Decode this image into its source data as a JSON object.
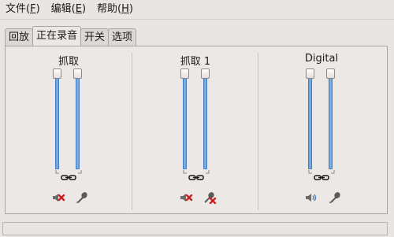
{
  "menu": {
    "file": {
      "label": "文件(",
      "accel": "F",
      "tail": ")"
    },
    "edit": {
      "label": "编辑(",
      "accel": "E",
      "tail": ")"
    },
    "help": {
      "label": "帮助(",
      "accel": "H",
      "tail": ")"
    }
  },
  "tabs": [
    {
      "label": "回放",
      "active": false
    },
    {
      "label": "正在录音",
      "active": true
    },
    {
      "label": "开关",
      "active": false
    },
    {
      "label": "选项",
      "active": false
    }
  ],
  "groups": [
    {
      "title": "抓取",
      "sliders": [
        1.0,
        1.0
      ],
      "locked": true,
      "icons": [
        "mute-icon",
        "microphone-icon"
      ]
    },
    {
      "title": "抓取 1",
      "sliders": [
        1.0,
        1.0
      ],
      "locked": true,
      "icons": [
        "mute-icon",
        "microphone-muted-icon"
      ]
    },
    {
      "title": "Digital",
      "sliders": [
        1.0,
        1.0
      ],
      "locked": true,
      "icons": [
        "speaker-icon",
        "microphone-icon"
      ]
    }
  ],
  "colors": {
    "accent": "#5d97d6",
    "mute_red": "#cc1f1f"
  }
}
